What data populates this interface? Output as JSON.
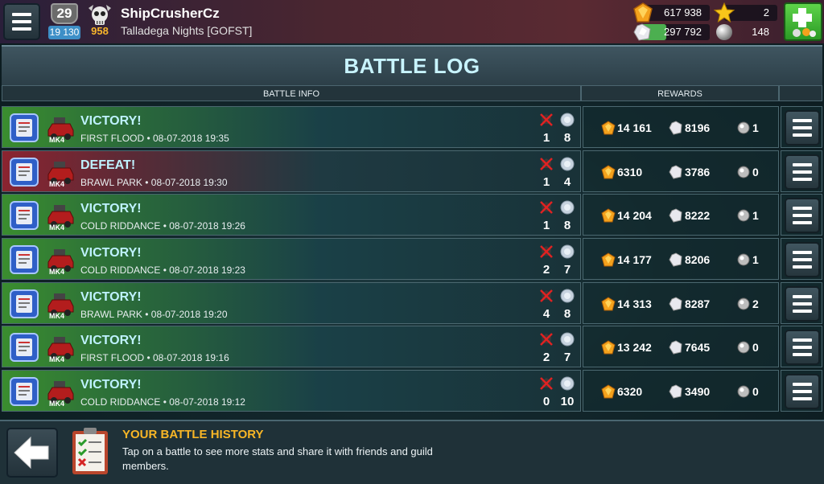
{
  "player": {
    "level": "29",
    "xp": "19 130",
    "gold_skulls": "958",
    "name": "ShipCrusherCz",
    "guild": "Talladega Nights [GOFST]"
  },
  "resources": {
    "gold": "617 938",
    "parts": "297 792",
    "stars": "2",
    "pearls": "148"
  },
  "title": "BATTLE LOG",
  "columns": {
    "info": "BATTLE INFO",
    "rewards": "REWARDS"
  },
  "battles": [
    {
      "result": "VICTORY!",
      "map": "FIRST FLOOD",
      "time": "08-07-2018 19:35",
      "kills": "1",
      "parts": "8",
      "gold": "14 161",
      "scrap": "8196",
      "pearls": "1",
      "outcome": "victory"
    },
    {
      "result": "DEFEAT!",
      "map": "BRAWL PARK",
      "time": "08-07-2018 19:30",
      "kills": "1",
      "parts": "4",
      "gold": "6310",
      "scrap": "3786",
      "pearls": "0",
      "outcome": "defeat"
    },
    {
      "result": "VICTORY!",
      "map": "COLD RIDDANCE",
      "time": "08-07-2018 19:26",
      "kills": "1",
      "parts": "8",
      "gold": "14 204",
      "scrap": "8222",
      "pearls": "1",
      "outcome": "victory"
    },
    {
      "result": "VICTORY!",
      "map": "COLD RIDDANCE",
      "time": "08-07-2018 19:23",
      "kills": "2",
      "parts": "7",
      "gold": "14 177",
      "scrap": "8206",
      "pearls": "1",
      "outcome": "victory"
    },
    {
      "result": "VICTORY!",
      "map": "BRAWL PARK",
      "time": "08-07-2018 19:20",
      "kills": "4",
      "parts": "8",
      "gold": "14 313",
      "scrap": "8287",
      "pearls": "2",
      "outcome": "victory"
    },
    {
      "result": "VICTORY!",
      "map": "FIRST FLOOD",
      "time": "08-07-2018 19:16",
      "kills": "2",
      "parts": "7",
      "gold": "13 242",
      "scrap": "7645",
      "pearls": "0",
      "outcome": "victory"
    },
    {
      "result": "VICTORY!",
      "map": "COLD RIDDANCE",
      "time": "08-07-2018 19:12",
      "kills": "0",
      "parts": "10",
      "gold": "6320",
      "scrap": "3490",
      "pearls": "0",
      "outcome": "victory"
    }
  ],
  "vehicle_mark": "MK4",
  "footer": {
    "title": "YOUR BATTLE HISTORY",
    "description": "Tap on a battle to see more stats and share it with friends and guild members."
  },
  "colors": {
    "victory": "#3a8d2f",
    "defeat": "#8b2430",
    "title_text": "#c8f4ff",
    "accent_gold": "#f8b626"
  },
  "icons": [
    "menu-icon",
    "level-shield-icon",
    "skull-icon",
    "gold-icon",
    "scrap-icon",
    "star-icon",
    "pearl-icon",
    "plus-icon",
    "mode-icon",
    "vehicle-icon",
    "kill-icon",
    "part-icon",
    "back-arrow-icon",
    "clipboard-icon"
  ]
}
